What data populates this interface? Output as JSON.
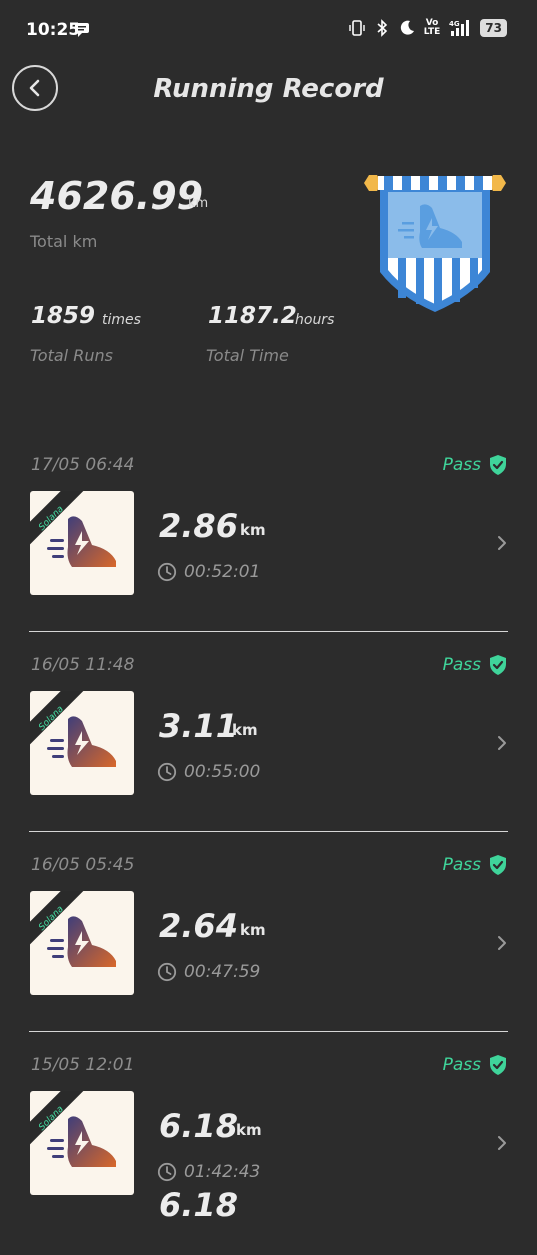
{
  "status": {
    "time": "10:25",
    "volte": "Vo\nLTE",
    "network": "4G",
    "battery": "73"
  },
  "header": {
    "title": "Running Record"
  },
  "summary": {
    "total_km_value": "4626.99",
    "total_km_unit": "km",
    "total_km_label": "Total km",
    "runs_value": "1859",
    "runs_unit": "times",
    "runs_label": "Total Runs",
    "time_value": "1187.2",
    "time_unit": "hours",
    "time_label": "Total Time"
  },
  "colors": {
    "pass": "#3fd49a",
    "badge": "#4a90d9",
    "background": "#2c2c2c"
  },
  "records": [
    {
      "date": "17/05 06:44",
      "status": "Pass",
      "tag": "Solana",
      "distance": "2.86",
      "unit": "km",
      "duration": "00:52:01"
    },
    {
      "date": "16/05 11:48",
      "status": "Pass",
      "tag": "Solana",
      "distance": "3.11",
      "unit": "km",
      "duration": "00:55:00"
    },
    {
      "date": "16/05 05:45",
      "status": "Pass",
      "tag": "Solana",
      "distance": "2.64",
      "unit": "km",
      "duration": "00:47:59"
    },
    {
      "date": "15/05 12:01",
      "status": "Pass",
      "tag": "Solana",
      "distance": "6.18",
      "unit": "km",
      "duration": "01:42:43"
    }
  ],
  "peek": {
    "distance": "6.18"
  }
}
